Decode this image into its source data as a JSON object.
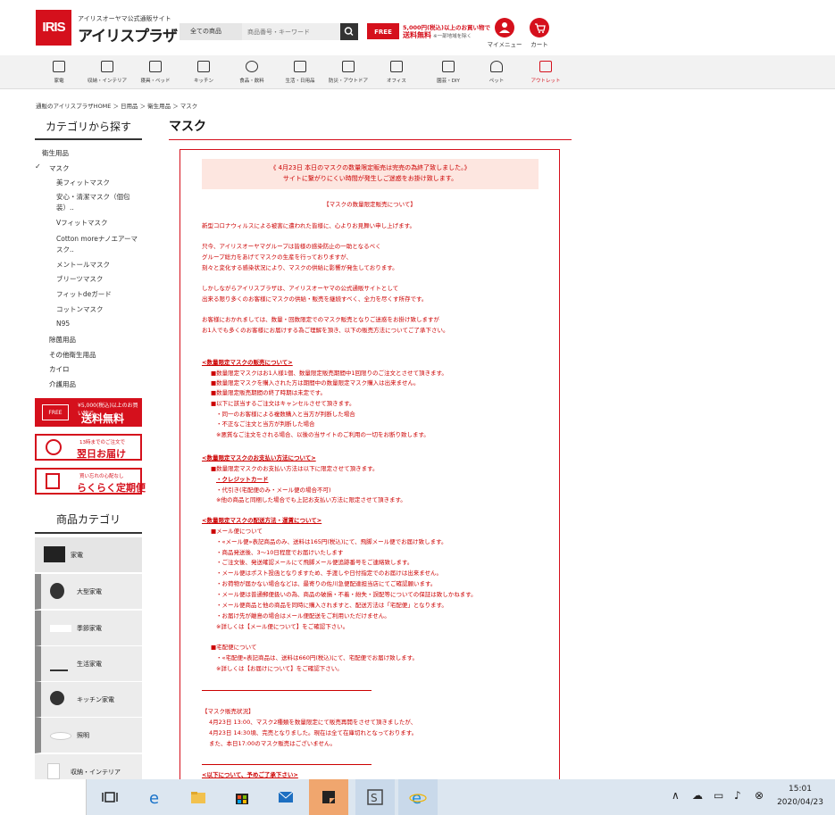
{
  "header": {
    "logo_text": "IRIS",
    "logo_sub": "アイリスオーヤマ公式通販サイト",
    "logo_main": "アイリスプラザ",
    "search_category": "全ての商品",
    "search_placeholder": "商品番号・キーワード",
    "ship_icon": "FREE",
    "ship_line1": "5,000円(税込)以上のお買い物で",
    "ship_line2": "送料無料",
    "ship_note": "※一部地域を除く",
    "mymenu": "マイメニュー",
    "cart": "カート"
  },
  "categories": [
    {
      "label": "家電",
      "icon": "appliance-icon"
    },
    {
      "label": "収納・インテリア",
      "icon": "storage-icon"
    },
    {
      "label": "寝具・ベッド",
      "icon": "bed-icon"
    },
    {
      "label": "キッチン",
      "icon": "kitchen-icon"
    },
    {
      "label": "食品・飲料",
      "icon": "food-icon"
    },
    {
      "label": "生活・日用品",
      "icon": "home-icon"
    },
    {
      "label": "防災・アウトドア",
      "icon": "tent-icon"
    },
    {
      "label": "オフィス",
      "icon": "office-icon"
    },
    {
      "label": "園芸・DIY",
      "icon": "garden-icon"
    },
    {
      "label": "ペット",
      "icon": "pet-icon"
    },
    {
      "label": "アウトレット",
      "icon": "outlet-icon"
    }
  ],
  "breadcrumb": "通販のアイリスプラザHOME ＞ 日用品 ＞ 衛生用品 ＞ マスク",
  "sidebar": {
    "heading": "カテゴリから探す",
    "items": [
      "衛生用品",
      "マスク",
      "美フィットマスク",
      "安心・清潔マスク（個包",
      "装）..",
      "Vフィットマスク",
      "Cotton moreナノエアーマ",
      "スク..",
      "メントールマスク",
      "ブリーツマスク",
      "フィットdeガード",
      "コットンマスク",
      "N95",
      "除菌用品",
      "その他衛生用品",
      "カイロ",
      "介護用品"
    ],
    "check": "✓",
    "banner1_icon": "FREE",
    "banner1_line1": "¥5,000(税込)以上のお買い物で",
    "banner1_line2": "送料無料",
    "banner2_line1": "13時までのご注文で",
    "banner2_line2": "翌日お届け",
    "banner3_line1": "買い忘れの心配なし",
    "banner3_line2": "らくらく定期便",
    "product_heading": "商品カテゴリ",
    "product_cats": [
      "家電",
      "大型家電",
      "季節家電",
      "生活家電",
      "キッチン家電",
      "照明",
      "収納・インテリア"
    ]
  },
  "page": {
    "title": "マスク",
    "notice_line1": "《 4月23日 本日のマスクの数量限定販売は完売の為終了致しました。》",
    "notice_line2": "サイトに繋がりにくい時間が発生しご迷惑をお掛け致します。",
    "section_title": "【マスクの数量限定販売について】",
    "lines": [
      "新型コロナウィルスによる被害に遭われた皆様に、心よりお見舞い申し上げます。",
      "只今、アイリスオーヤマグループは皆様の感染防止の一助となるべく",
      "グループ総力をあげてマスクの生産を行っておりますが、",
      "刻々と変化する感染状況により、マスクの供給に影響が発生しております。",
      "しかしながらアイリスプラザは、アイリスオーヤマの公式通販サイトとして",
      "出来る限り多くのお客様にマスクの供給・販売を継続すべく、全力を尽くす所存です。",
      "お客様におかれましては、数量・回数限定でのマスク販売となりご迷惑をお掛け致しますが",
      "お1人でも多くのお客様にお届けする為ご理解を頂き、以下の販売方法についてご了承下さい。",
      "<数量限定マスクの販売について>",
      "■数量限定マスクはお1人様1個、数量限定販売期間中1回限りのご注文とさせて頂きます。",
      "■数量限定マスクを購入された方は期間中の数量限定マスク購入は出来ません。",
      "■数量限定販売期間の終了時期は未定です。",
      "■以下に該当するご注文はキャンセルさせて頂きます。",
      "・同一のお客様による複数購入と当方が判断した場合",
      "・不正なご注文と当方が判断した場合",
      "※悪質なご注文をされる場合、以後の当サイトのご利用の一切をお断り致します。",
      "<数量限定マスクのお支払い方法について>",
      "■数量限定マスクのお支払い方法は以下に限定させて頂きます。",
      "・クレジットカード",
      "・代引き(宅配便のみ・メール便の場合不可)",
      "※他の商品と同梱した場合でも上記お支払い方法に限定させて頂きます。",
      "<数量限定マスクの配送方法・運賃について>",
      "■メール便について",
      "・«メール便»表記商品のみ、送料は165円(税込)にて、飛脚メール便でお届け致します。",
      "・商品発送後、3〜10日程度でお届けいたします",
      "・ご注文後、発送確認メールにて飛脚メール便追跡番号をご連絡致します。",
      "・メール便はポスト投函となりますため、手渡しや日付指定でのお届けは出来ません。",
      "・お荷物が届かない場合などは、最寄りの佐川急便配達担当店にてご確認願います。",
      "・メール便は普通郵便扱いの為、商品の破損・不着・紛失・誤配等についての保証は致しかねます。",
      "・メール便商品と他の商品を同時に購入されますと、配送方法は「宅配便」となります。",
      "・お届け先が離島の場合はメール便配送をご利用いただけません。",
      "※詳しくは【メール便について】をご確認下さい。",
      "■宅配便について",
      "・«宅配便»表記商品は、送料は660円(税込)にて、宅配便でお届け致します。",
      "※詳しくは【お届けについて】をご確認下さい。",
      "【マスク販売状況】",
      "4月23日 13:00、マスク2種類を数量限定にて販売再開をさせて頂きましたが、",
      "4月23日 14:30頃、完売となりました。現在は全て在庫切れとなっております。",
      "また、本日17:00のマスク販売はございません。",
      "<以下について、予めご了承下さい>"
    ]
  },
  "taskbar": {
    "time": "15:01",
    "date": "2020/04/23"
  },
  "colors": {
    "brand_red": "#d5101c",
    "notice_bg": "#fde6e0"
  }
}
